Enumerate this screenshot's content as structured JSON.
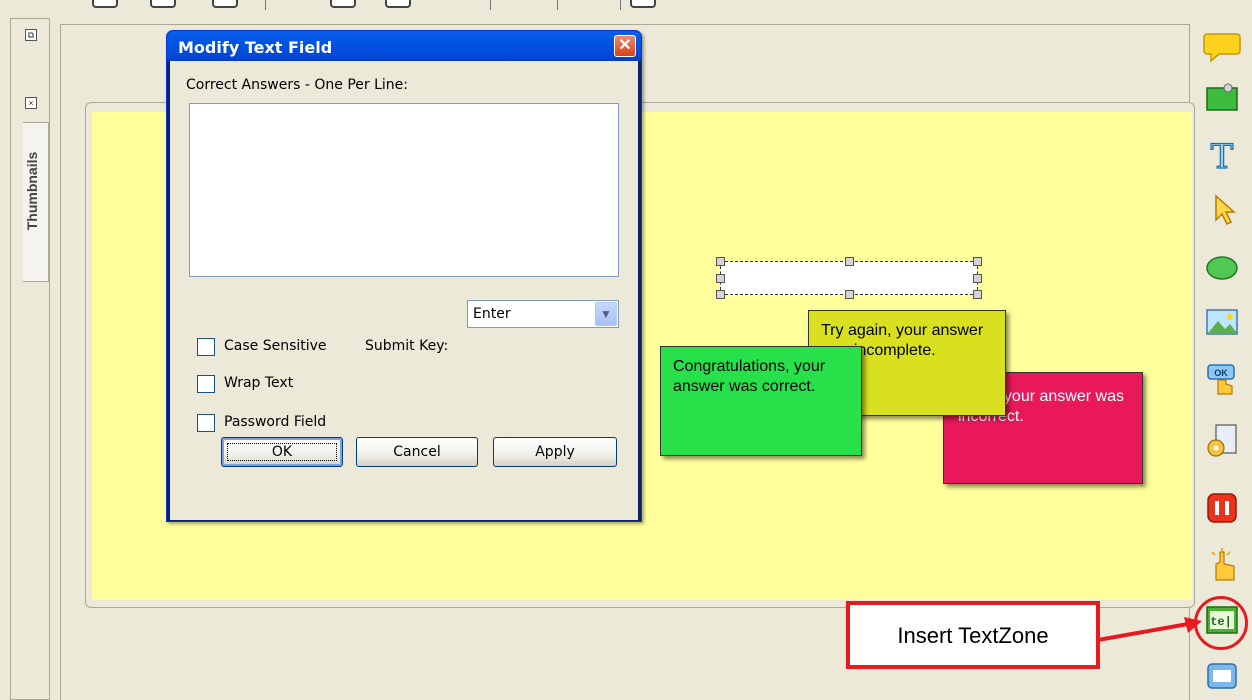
{
  "app": {
    "panel_label": "Thumbnails"
  },
  "dialog": {
    "title": "Modify Text Field",
    "answers_label": "Correct Answers - One Per Line:",
    "answers_value": "",
    "case_sensitive_label": "Case Sensitive",
    "case_sensitive_checked": false,
    "submit_key_label": "Submit Key:",
    "submit_key_value": "Enter",
    "wrap_text_label": "Wrap Text",
    "wrap_text_checked": false,
    "password_label": "Password Field",
    "password_checked": false,
    "ok_label": "OK",
    "cancel_label": "Cancel",
    "apply_label": "Apply",
    "close_glyph": "✕"
  },
  "slide": {
    "feedback_correct": "Congratulations, your answer was correct.",
    "feedback_incomplete": "Try again, your answer was incomplete.",
    "feedback_incorrect": "Sorry, your answer was incorrect.",
    "colors": {
      "correct": "#28e04a",
      "incomplete": "#d8e020",
      "incorrect": "#e8185a",
      "background": "#ffff9b"
    }
  },
  "right_toolbar": {
    "icons": [
      "caption-icon",
      "highlight-box-icon",
      "text-icon",
      "cursor-icon",
      "shape-icon",
      "image-icon",
      "button-icon",
      "animation-icon",
      "pause-icon",
      "click-zone-icon",
      "text-zone-icon",
      "message-icon"
    ]
  },
  "annotation": {
    "label": "Insert TextZone",
    "color": "#e8191f"
  }
}
